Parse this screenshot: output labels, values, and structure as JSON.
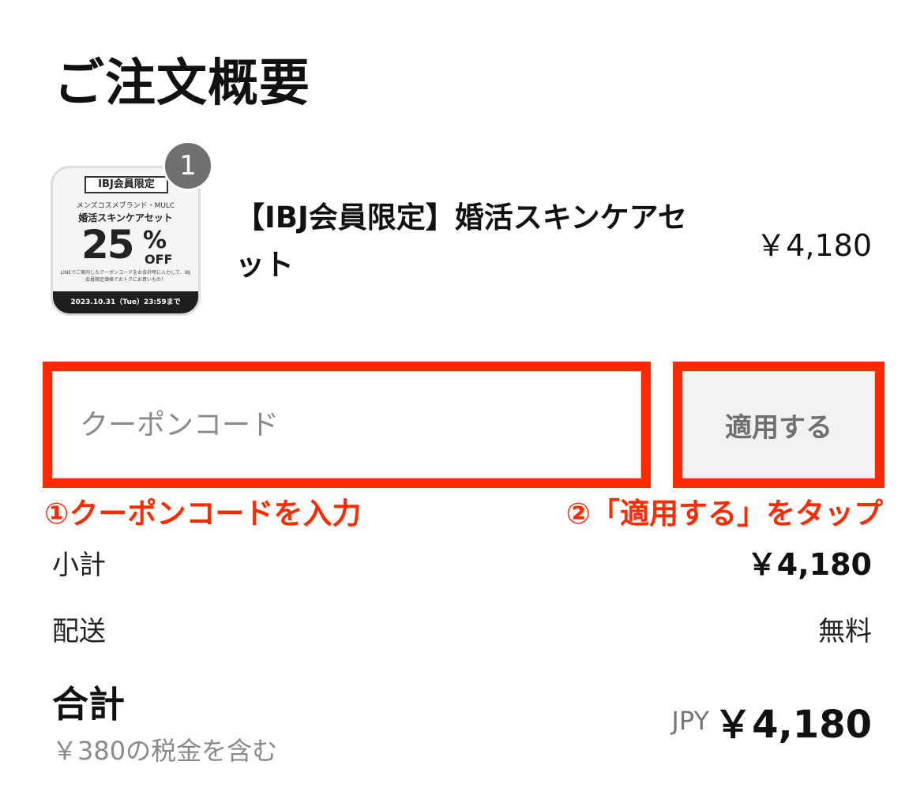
{
  "order_summary": {
    "title": "ご注文概要",
    "item": {
      "quantity": "1",
      "name": "【IBJ会員限定】婚活スキンケアセット",
      "price": "￥4,180",
      "thumbnail": {
        "tag": "IBJ会員限定",
        "brand": "メンズコスメブランド・MULC",
        "set_name": "婚活スキンケアセット",
        "discount": "25",
        "percent_sign": "%",
        "off": "OFF",
        "note": "LINEでご案内したクーポンコードをお会計時に入力して、IBJ会員限定価格でおトクにお買いもの！",
        "deadline": "2023.10.31（Tue）23:59まで"
      }
    },
    "coupon": {
      "placeholder": "クーポンコード",
      "value": "",
      "apply_label": "適用する"
    },
    "annotations": {
      "step1": "①クーポンコードを入力",
      "step2": "②「適用する」をタップ",
      "color": "#ff2a00"
    },
    "subtotal": {
      "label": "小計",
      "value": "￥4,180"
    },
    "shipping": {
      "label": "配送",
      "value": "無料"
    },
    "total": {
      "label": "合計",
      "tax_note": "￥380の税金を含む",
      "currency": "JPY",
      "value": "￥4,180"
    }
  }
}
